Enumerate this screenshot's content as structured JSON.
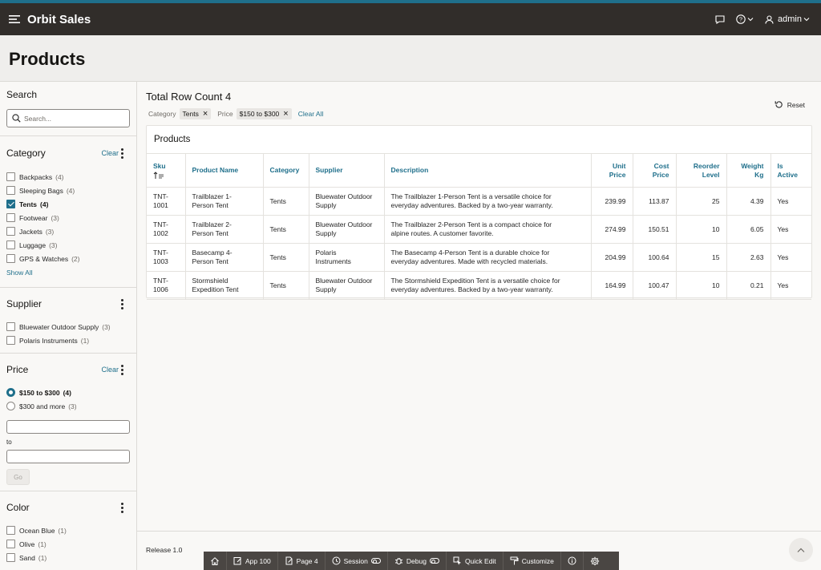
{
  "header": {
    "app_title": "Orbit Sales",
    "user": "admin"
  },
  "page": {
    "title": "Products"
  },
  "search": {
    "title": "Search",
    "placeholder": "Search..."
  },
  "facets": {
    "category": {
      "title": "Category",
      "clear": "Clear",
      "items": [
        {
          "label": "Backpacks",
          "count": "(4)",
          "checked": false
        },
        {
          "label": "Sleeping Bags",
          "count": "(4)",
          "checked": false
        },
        {
          "label": "Tents",
          "count": "(4)",
          "checked": true
        },
        {
          "label": "Footwear",
          "count": "(3)",
          "checked": false
        },
        {
          "label": "Jackets",
          "count": "(3)",
          "checked": false
        },
        {
          "label": "Luggage",
          "count": "(3)",
          "checked": false
        },
        {
          "label": "GPS & Watches",
          "count": "(2)",
          "checked": false
        }
      ],
      "show_all": "Show All"
    },
    "supplier": {
      "title": "Supplier",
      "items": [
        {
          "label": "Bluewater Outdoor Supply",
          "count": "(3)"
        },
        {
          "label": "Polaris Instruments",
          "count": "(1)"
        }
      ]
    },
    "price": {
      "title": "Price",
      "clear": "Clear",
      "items": [
        {
          "label": "$150 to $300",
          "count": "(4)",
          "selected": true
        },
        {
          "label": "$300 and more",
          "count": "(3)",
          "selected": false
        }
      ],
      "to_label": "to",
      "go_label": "Go"
    },
    "color": {
      "title": "Color",
      "items": [
        {
          "label": "Ocean Blue",
          "count": "(1)"
        },
        {
          "label": "Olive",
          "count": "(1)"
        },
        {
          "label": "Sand",
          "count": "(1)"
        }
      ]
    }
  },
  "results": {
    "row_count": "Total Row Count 4",
    "filters": {
      "category_label": "Category",
      "category_value": "Tents",
      "price_label": "Price",
      "price_value": "$150 to $300",
      "clear_all": "Clear All"
    },
    "reset_label": "Reset",
    "card_title": "Products",
    "columns": {
      "sku": "Sku",
      "product_name": "Product Name",
      "category": "Category",
      "supplier": "Supplier",
      "description": "Description",
      "unit_price_1": "Unit",
      "unit_price_2": "Price",
      "cost_price_1": "Cost",
      "cost_price_2": "Price",
      "reorder_1": "Reorder",
      "reorder_2": "Level",
      "weight_1": "Weight",
      "weight_2": "Kg",
      "active_1": "Is",
      "active_2": "Active"
    },
    "rows": [
      {
        "sku_1": "TNT-",
        "sku_2": "1001",
        "name_1": "Trailblazer 1-",
        "name_2": "Person Tent",
        "category": "Tents",
        "supplier_1": "Bluewater Outdoor",
        "supplier_2": "Supply",
        "desc_1": "The Trailblazer 1-Person Tent is a versatile choice for",
        "desc_2": "everyday adventures. Backed by a two-year warranty.",
        "unit_price": "239.99",
        "cost_price": "113.87",
        "reorder": "25",
        "weight": "4.39",
        "active": "Yes"
      },
      {
        "sku_1": "TNT-",
        "sku_2": "1002",
        "name_1": "Trailblazer 2-",
        "name_2": "Person Tent",
        "category": "Tents",
        "supplier_1": "Bluewater Outdoor",
        "supplier_2": "Supply",
        "desc_1": "The Trailblazer 2-Person Tent is a compact choice for",
        "desc_2": "alpine routes. A customer favorite.",
        "unit_price": "274.99",
        "cost_price": "150.51",
        "reorder": "10",
        "weight": "6.05",
        "active": "Yes"
      },
      {
        "sku_1": "TNT-",
        "sku_2": "1003",
        "name_1": "Basecamp 4-",
        "name_2": "Person Tent",
        "category": "Tents",
        "supplier_1": "Polaris",
        "supplier_2": "Instruments",
        "desc_1": "The Basecamp 4-Person Tent is a durable choice for",
        "desc_2": "everyday adventures. Made with recycled materials.",
        "unit_price": "204.99",
        "cost_price": "100.64",
        "reorder": "15",
        "weight": "2.63",
        "active": "Yes"
      },
      {
        "sku_1": "TNT-",
        "sku_2": "1006",
        "name_1": "Stormshield",
        "name_2": "Expedition Tent",
        "category": "Tents",
        "supplier_1": "Bluewater Outdoor",
        "supplier_2": "Supply",
        "desc_1": "The Stormshield Expedition Tent is a versatile choice for",
        "desc_2": "everyday adventures. Backed by a two-year warranty.",
        "unit_price": "164.99",
        "cost_price": "100.47",
        "reorder": "10",
        "weight": "0.21",
        "active": "Yes"
      }
    ]
  },
  "footer": {
    "release": "Release 1.0"
  },
  "devbar": {
    "app": "App 100",
    "page": "Page 4",
    "session": "Session",
    "debug": "Debug",
    "quick_edit": "Quick Edit",
    "customize": "Customize"
  },
  "colors": {
    "accent": "#1f6f8b",
    "header_bg": "#312d2a",
    "devbar_bg": "#4a4643"
  }
}
